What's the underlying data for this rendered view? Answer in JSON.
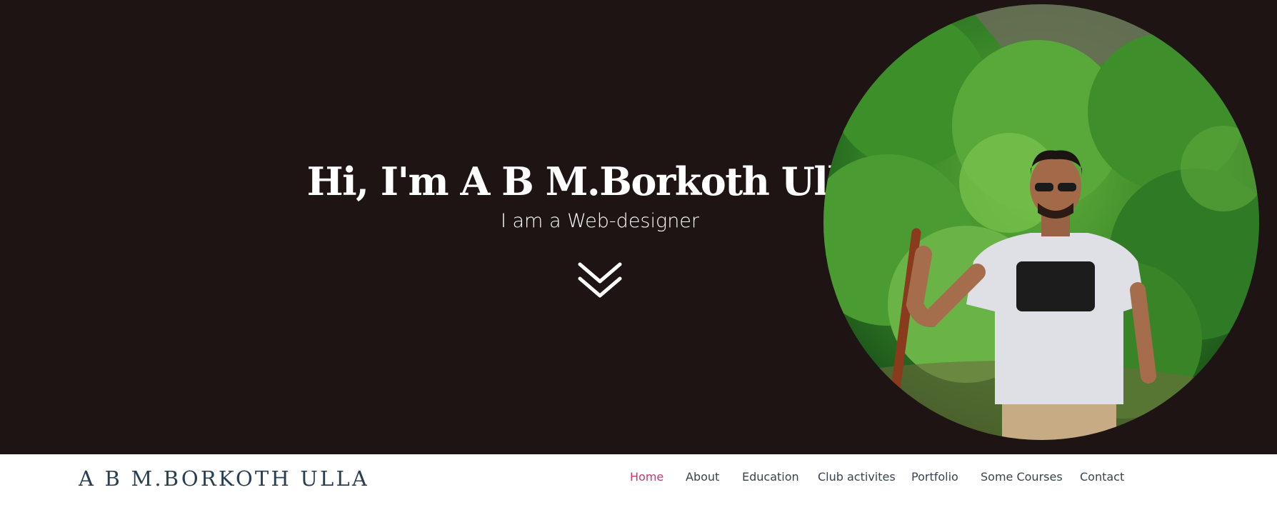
{
  "hero": {
    "title": "Hi, I'm A B M.Borkoth Ulla !",
    "subtitle": "I am a Web-designer",
    "scroll_icon": "double-chevron-down-icon",
    "background_color": "#1e1413"
  },
  "navbar": {
    "brand": "A B M.BORKOTH ULLA",
    "active_color": "#c2396b",
    "items": [
      {
        "label": "Home",
        "active": true
      },
      {
        "label": "About",
        "active": false
      },
      {
        "label": "Education",
        "active": false
      },
      {
        "label": "Club activites",
        "active": false
      },
      {
        "label": "Portfolio",
        "active": false
      },
      {
        "label": "Some Courses",
        "active": false
      },
      {
        "label": "Contact",
        "active": false
      }
    ]
  }
}
